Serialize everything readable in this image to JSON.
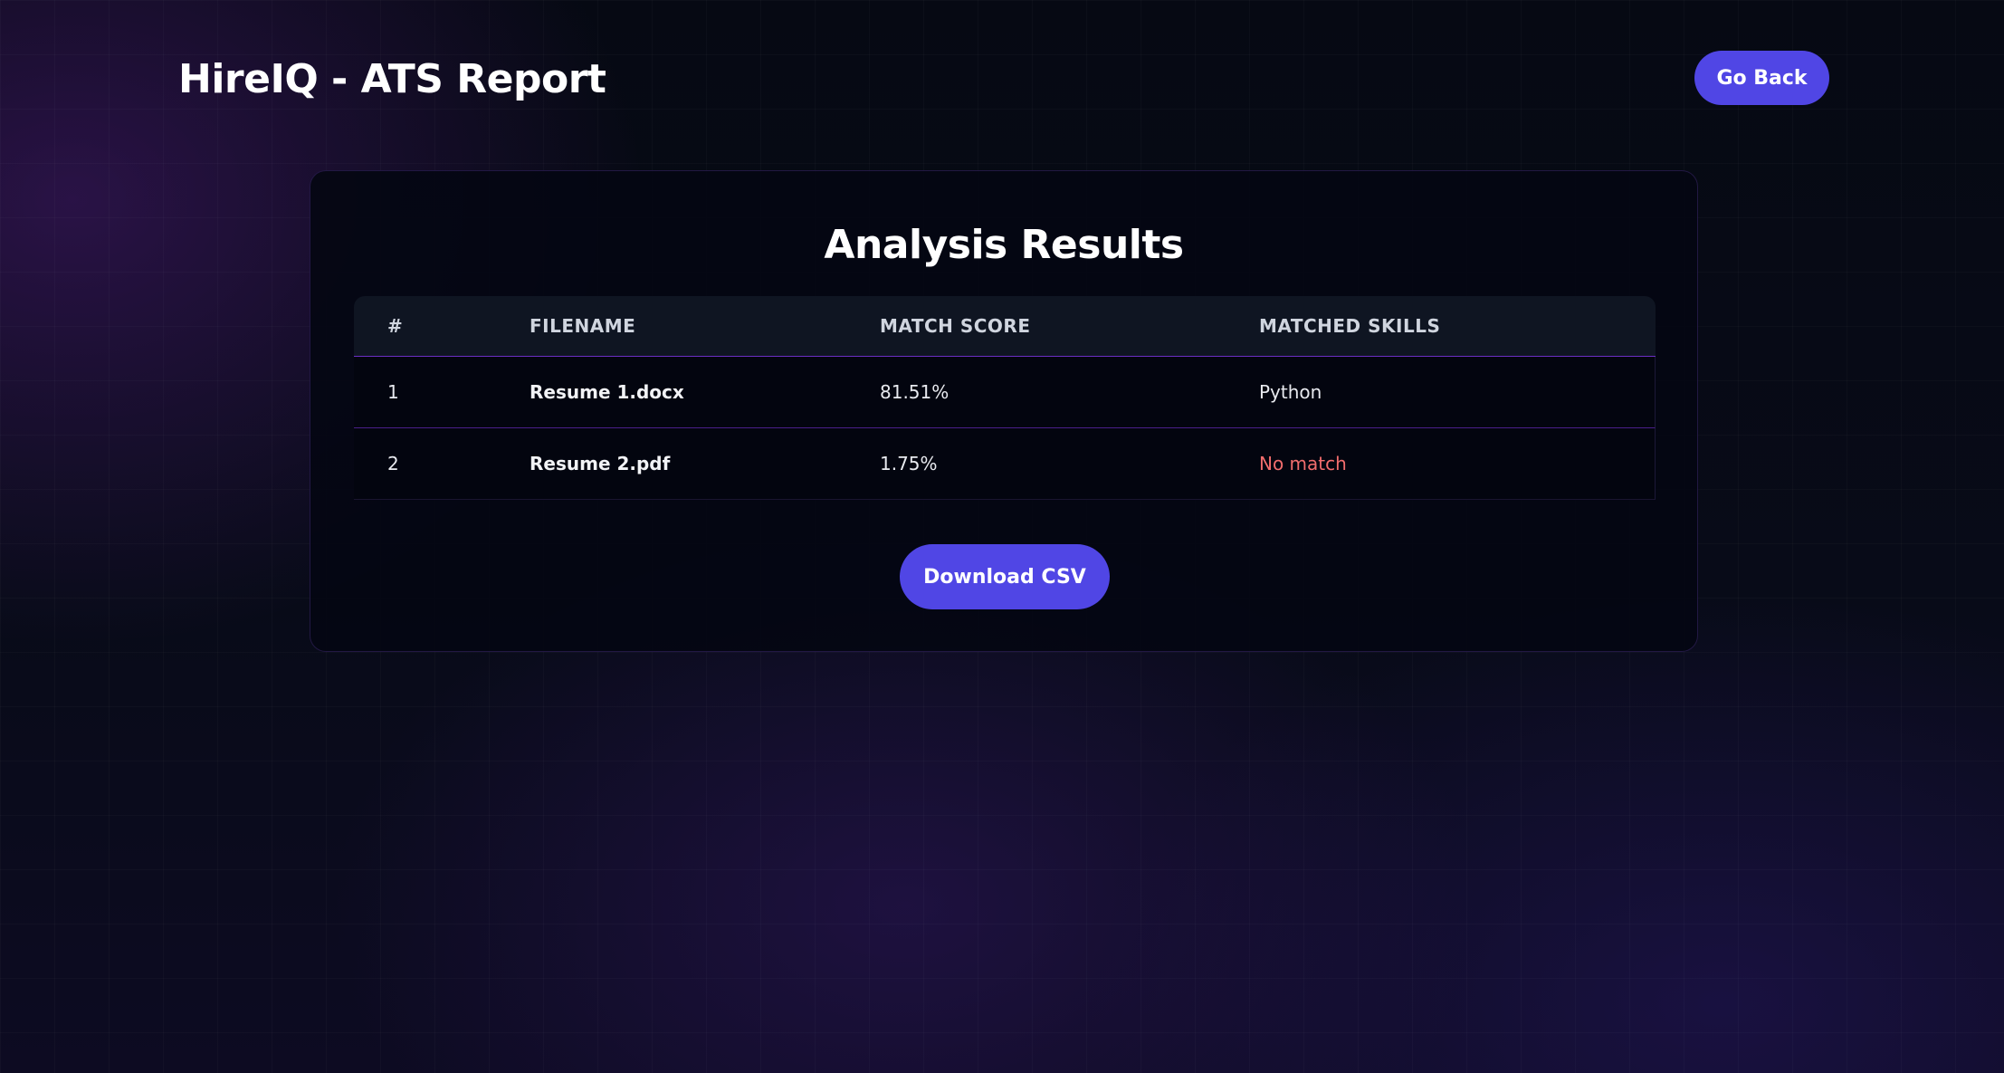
{
  "header": {
    "app_title": "HireIQ - ATS Report",
    "go_back_label": "Go Back"
  },
  "results": {
    "title": "Analysis Results",
    "columns": [
      "#",
      "FILENAME",
      "MATCH SCORE",
      "MATCHED SKILLS"
    ],
    "rows": [
      {
        "index": "1",
        "filename": "Resume 1.docx",
        "match_score": "81.51%",
        "matched_skills": "Python"
      },
      {
        "index": "2",
        "filename": "Resume 2.pdf",
        "match_score": "1.75%",
        "matched_skills": "No match"
      }
    ],
    "download_label": "Download CSV"
  },
  "colors": {
    "accent": "#5046e5",
    "no_match": "#f26d6d",
    "row_divider": "#6b2fc4",
    "background": "#070a16"
  }
}
